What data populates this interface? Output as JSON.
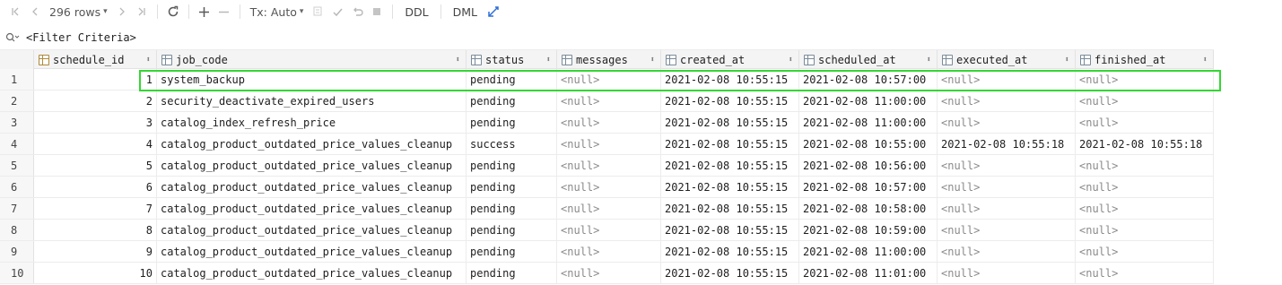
{
  "toolbar": {
    "first_icon": "first-page-icon",
    "prev_icon": "prev-page-icon",
    "rows_label": "296 rows",
    "next_icon": "next-page-icon",
    "last_icon": "last-page-icon",
    "refresh_icon": "refresh-icon",
    "add_icon": "add-row-icon",
    "remove_icon": "remove-row-icon",
    "tx_label": "Tx: Auto",
    "commit_icon": "commit-icon",
    "check_icon": "check-icon",
    "revert_icon": "revert-icon",
    "stop_icon": "stop-icon",
    "ddl_label": "DDL",
    "dml_label": "DML",
    "compare_icon": "compare-icon"
  },
  "filter": {
    "icon": "filter-search-icon",
    "text": "<Filter Criteria>"
  },
  "columns": [
    {
      "name": "schedule_id",
      "icon": "key-column-icon"
    },
    {
      "name": "job_code",
      "icon": "column-icon"
    },
    {
      "name": "status",
      "icon": "column-icon"
    },
    {
      "name": "messages",
      "icon": "column-icon"
    },
    {
      "name": "created_at",
      "icon": "column-icon"
    },
    {
      "name": "scheduled_at",
      "icon": "column-icon"
    },
    {
      "name": "executed_at",
      "icon": "column-icon"
    },
    {
      "name": "finished_at",
      "icon": "column-icon"
    }
  ],
  "rows": [
    {
      "n": "1",
      "id": "1",
      "job": "system_backup",
      "status": "pending",
      "msg": "<null>",
      "created": "2021-02-08 10:55:15",
      "scheduled": "2021-02-08 10:57:00",
      "executed": "<null>",
      "finished": "<null>"
    },
    {
      "n": "2",
      "id": "2",
      "job": "security_deactivate_expired_users",
      "status": "pending",
      "msg": "<null>",
      "created": "2021-02-08 10:55:15",
      "scheduled": "2021-02-08 11:00:00",
      "executed": "<null>",
      "finished": "<null>"
    },
    {
      "n": "3",
      "id": "3",
      "job": "catalog_index_refresh_price",
      "status": "pending",
      "msg": "<null>",
      "created": "2021-02-08 10:55:15",
      "scheduled": "2021-02-08 11:00:00",
      "executed": "<null>",
      "finished": "<null>"
    },
    {
      "n": "4",
      "id": "4",
      "job": "catalog_product_outdated_price_values_cleanup",
      "status": "success",
      "msg": "<null>",
      "created": "2021-02-08 10:55:15",
      "scheduled": "2021-02-08 10:55:00",
      "executed": "2021-02-08 10:55:18",
      "finished": "2021-02-08 10:55:18"
    },
    {
      "n": "5",
      "id": "5",
      "job": "catalog_product_outdated_price_values_cleanup",
      "status": "pending",
      "msg": "<null>",
      "created": "2021-02-08 10:55:15",
      "scheduled": "2021-02-08 10:56:00",
      "executed": "<null>",
      "finished": "<null>"
    },
    {
      "n": "6",
      "id": "6",
      "job": "catalog_product_outdated_price_values_cleanup",
      "status": "pending",
      "msg": "<null>",
      "created": "2021-02-08 10:55:15",
      "scheduled": "2021-02-08 10:57:00",
      "executed": "<null>",
      "finished": "<null>"
    },
    {
      "n": "7",
      "id": "7",
      "job": "catalog_product_outdated_price_values_cleanup",
      "status": "pending",
      "msg": "<null>",
      "created": "2021-02-08 10:55:15",
      "scheduled": "2021-02-08 10:58:00",
      "executed": "<null>",
      "finished": "<null>"
    },
    {
      "n": "8",
      "id": "8",
      "job": "catalog_product_outdated_price_values_cleanup",
      "status": "pending",
      "msg": "<null>",
      "created": "2021-02-08 10:55:15",
      "scheduled": "2021-02-08 10:59:00",
      "executed": "<null>",
      "finished": "<null>"
    },
    {
      "n": "9",
      "id": "9",
      "job": "catalog_product_outdated_price_values_cleanup",
      "status": "pending",
      "msg": "<null>",
      "created": "2021-02-08 10:55:15",
      "scheduled": "2021-02-08 11:00:00",
      "executed": "<null>",
      "finished": "<null>"
    },
    {
      "n": "10",
      "id": "10",
      "job": "catalog_product_outdated_price_values_cleanup",
      "status": "pending",
      "msg": "<null>",
      "created": "2021-02-08 10:55:15",
      "scheduled": "2021-02-08 11:01:00",
      "executed": "<null>",
      "finished": "<null>"
    }
  ],
  "colors": {
    "highlight": "#33d633",
    "null_text": "#8a8a8a",
    "header_bg": "#f4f4f4"
  }
}
